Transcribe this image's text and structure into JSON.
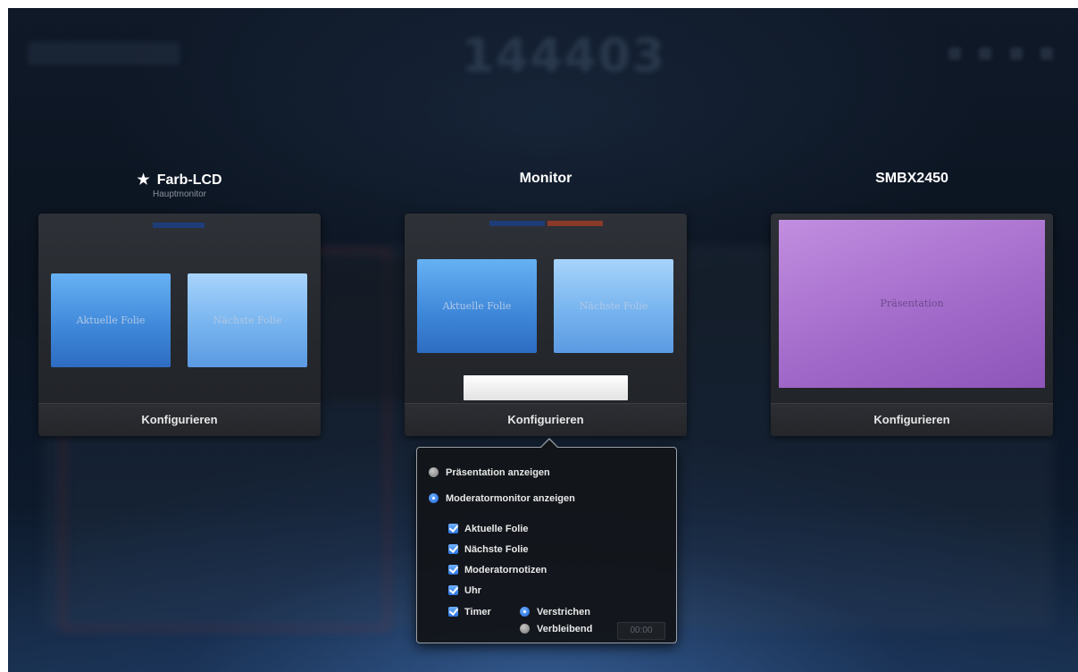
{
  "background": {
    "clock": "144403"
  },
  "displays": [
    {
      "star": "★",
      "name": "Farb-LCD",
      "subtitle": "Hauptmonitor",
      "current_slide": "Aktuelle Folie",
      "next_slide": "Nächste Folie",
      "configure": "Konfigurieren"
    },
    {
      "name": "Monitor",
      "current_slide": "Aktuelle Folie",
      "next_slide": "Nächste Folie",
      "configure": "Konfigurieren"
    },
    {
      "name": "SMBX2450",
      "presentation": "Präsentation",
      "configure": "Konfigurieren"
    }
  ],
  "popover": {
    "show_presentation": "Präsentation anzeigen",
    "show_presenter_display": "Moderatormonitor anzeigen",
    "checks": {
      "current_slide": "Aktuelle Folie",
      "next_slide": "Nächste Folie",
      "notes": "Moderatornotizen",
      "clock": "Uhr",
      "timer": "Timer"
    },
    "elapsed": "Verstrichen",
    "remaining": "Verbleibend",
    "timer_value": "00:00"
  },
  "colors": {
    "accent": "#2c74e0",
    "current_slide": "#3d86d8",
    "next_slide": "#77b4ef",
    "presentation": "#a068c8"
  }
}
